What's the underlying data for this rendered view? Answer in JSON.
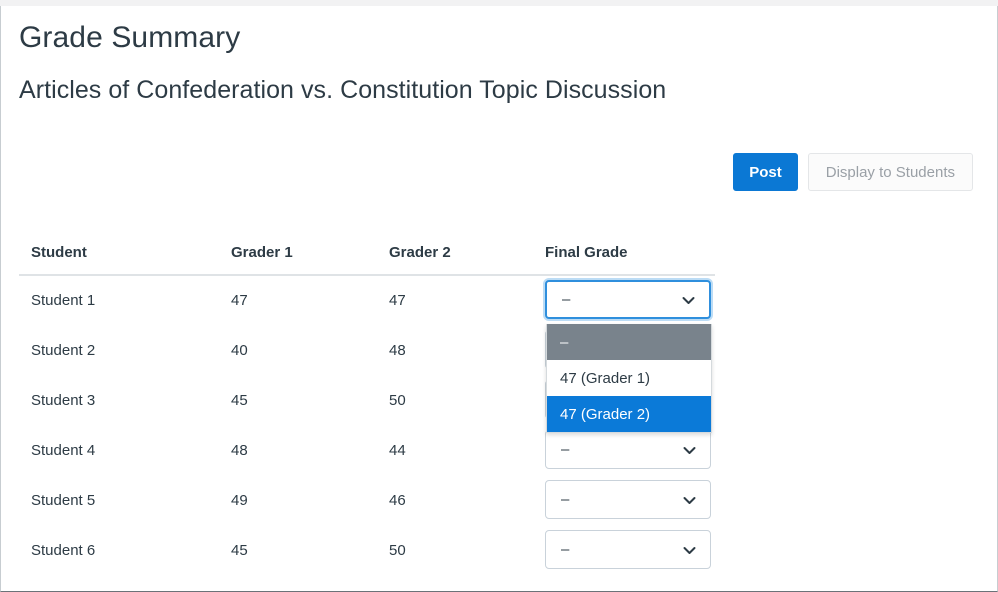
{
  "page": {
    "title": "Grade Summary",
    "subtitle": "Articles of Confederation vs. Constitution Topic Discussion"
  },
  "actions": {
    "post_label": "Post",
    "display_label": "Display to Students",
    "primary_color": "#0b78d4",
    "disabled_text_color": "#9aa0a6"
  },
  "table": {
    "headers": {
      "student": "Student",
      "grader1": "Grader 1",
      "grader2": "Grader 2",
      "final": "Final Grade"
    },
    "rows": [
      {
        "student": "Student 1",
        "grader1": "47",
        "grader2": "47",
        "final": "–"
      },
      {
        "student": "Student 2",
        "grader1": "40",
        "grader2": "48",
        "final": "–"
      },
      {
        "student": "Student 3",
        "grader1": "45",
        "grader2": "50",
        "final": "–"
      },
      {
        "student": "Student 4",
        "grader1": "48",
        "grader2": "44",
        "final": "–"
      },
      {
        "student": "Student 5",
        "grader1": "49",
        "grader2": "46",
        "final": "–"
      },
      {
        "student": "Student 6",
        "grader1": "45",
        "grader2": "50",
        "final": "–"
      }
    ]
  },
  "dropdown": {
    "open_for_row": "Student 1",
    "selected_value": "–",
    "highlight_color": "#0b7ad8",
    "selected_color": "#79838c",
    "options": [
      {
        "label": "–",
        "state": "selected"
      },
      {
        "label": "47 (Grader 1)",
        "state": "normal"
      },
      {
        "label": "47 (Grader 2)",
        "state": "hovered"
      }
    ]
  },
  "icons": {
    "chevron_down": "chevron-down-icon"
  }
}
